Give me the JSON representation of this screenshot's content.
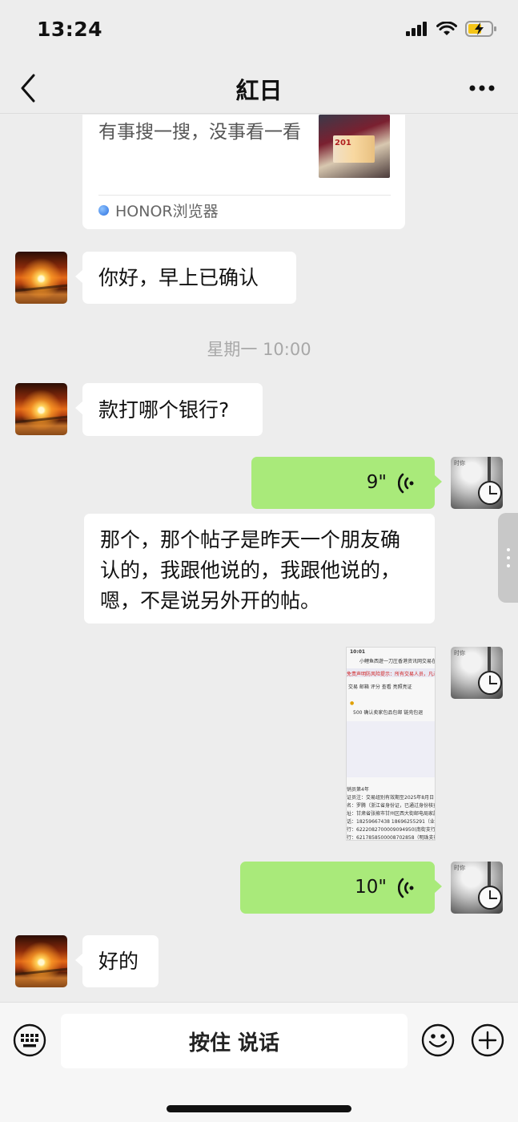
{
  "status_bar": {
    "time": "13:24"
  },
  "header": {
    "title": "紅日"
  },
  "link_card": {
    "text": "有事搜一搜，没事看一看",
    "thumb_text": "201",
    "source": "HONOR浏览器"
  },
  "messages": [
    {
      "from": "other",
      "type": "text",
      "text": "你好，早上已确认"
    },
    {
      "type": "time",
      "text": "星期一 10:00"
    },
    {
      "from": "other",
      "type": "text",
      "text": "款打哪个银行?"
    },
    {
      "from": "me",
      "type": "voice",
      "duration": "9\""
    },
    {
      "from": "me",
      "type": "transcript",
      "text": "那个，那个帖子是昨天一个朋友确认的，我跟他说的，我跟他说的，嗯，不是说另外开的帖。"
    },
    {
      "from": "me",
      "type": "image"
    },
    {
      "from": "me",
      "type": "voice",
      "duration": "10\""
    },
    {
      "from": "other",
      "type": "text",
      "text": "好的"
    }
  ],
  "screenshot": {
    "time": "10:01",
    "title": "小鲤鱼西遊一刀圧香港资讯网交易在",
    "warning": "免责声明防风险提示：所有交易人员，凡未",
    "tabs": "交易 邮箱 评分 查看 亮照亮证",
    "line1": "500  确认卖家包品包邮  链壳包退",
    "footer1": "销员第4年",
    "footer2": "证员注：交易组别有效期至2025年8月日",
    "footer3": "名：罗腾（浙江省身份证，已通过身份核查",
    "footer4": "址：甘肃省张掖市甘州区西大街邮电局家属",
    "footer5": "话：18259667438 18696255291（业务往来如",
    "footer6": "行：6222082700009094950(南街支行)",
    "footer7": "行：6217858500008702858（明珠支行）"
  },
  "avatar_clock_text": "时你",
  "input": {
    "hold_to_talk": "按住 说话"
  }
}
